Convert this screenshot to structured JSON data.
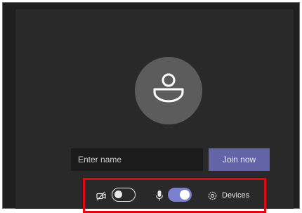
{
  "prejoin": {
    "name_placeholder": "Enter name",
    "name_value": "",
    "join_label": "Join now"
  },
  "controls": {
    "camera_on": false,
    "mic_on": true,
    "devices_label": "Devices"
  },
  "icons": {
    "avatar": "person-icon",
    "camera": "camera-off-icon",
    "mic": "microphone-icon",
    "devices": "gear-icon"
  },
  "colors": {
    "accent": "#6264a7",
    "toggle_on": "#7b7fd0",
    "highlight_border": "#e30613",
    "background": "#292929"
  }
}
